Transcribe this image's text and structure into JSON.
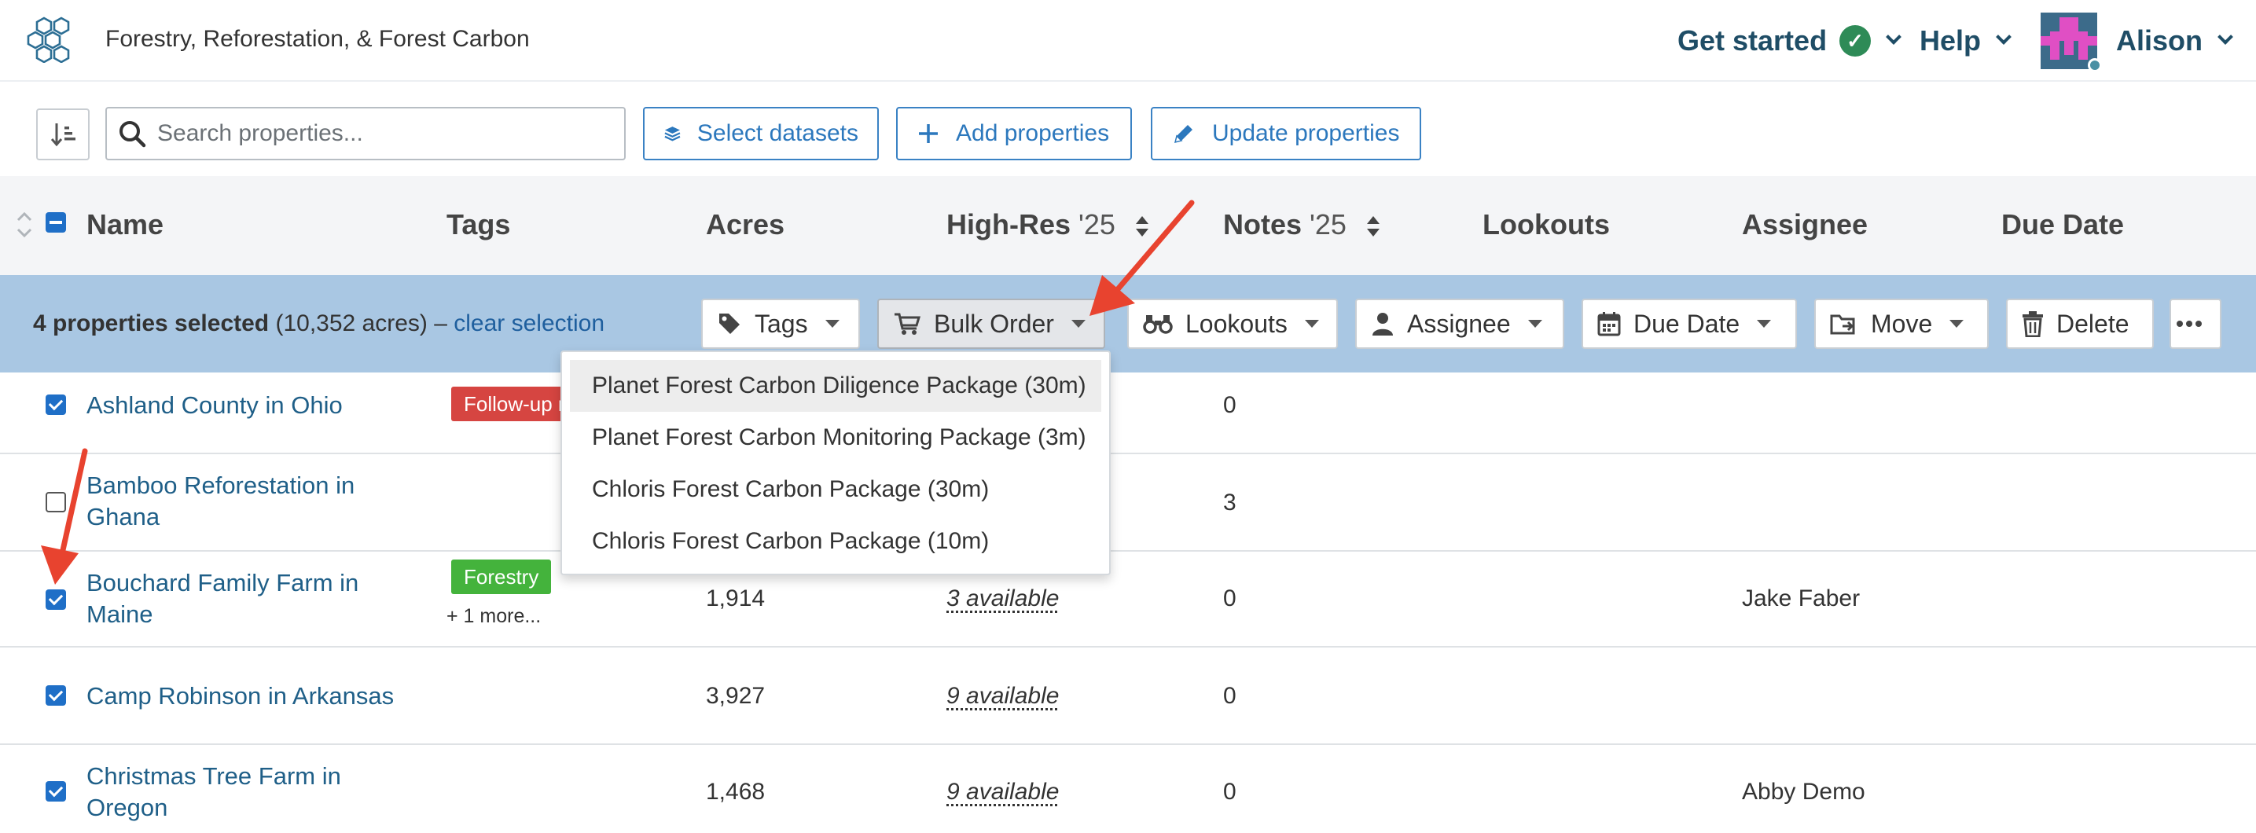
{
  "header": {
    "app_title": "Forestry, Reforestation, & Forest Carbon",
    "get_started_label": "Get started",
    "help_label": "Help",
    "user_name": "Alison"
  },
  "toolbar": {
    "search_placeholder": "Search properties...",
    "select_datasets_label": "Select datasets",
    "add_properties_label": "Add properties",
    "update_properties_label": "Update properties"
  },
  "table": {
    "columns": {
      "name": "Name",
      "tags": "Tags",
      "acres": "Acres",
      "highres": "High-Res",
      "highres_year": "'25",
      "notes": "Notes",
      "notes_year": "'25",
      "lookouts": "Lookouts",
      "assignee": "Assignee",
      "due_date": "Due Date"
    },
    "rows": [
      {
        "checked": true,
        "name": "Ashland County in Ohio",
        "tag": "Follow-up r",
        "acres": "",
        "highres": "",
        "notes": "0",
        "assignee": ""
      },
      {
        "checked": false,
        "name": "Bamboo Reforestation in Ghana",
        "tag": "",
        "acres": "",
        "highres": "",
        "notes": "3",
        "assignee": ""
      },
      {
        "checked": true,
        "name": "Bouchard Family Farm in Maine",
        "tag": "Forestry",
        "more": "+ 1 more...",
        "acres": "1,914",
        "highres": "3 available",
        "notes": "0",
        "assignee": "Jake Faber"
      },
      {
        "checked": true,
        "name": "Camp Robinson in Arkansas",
        "tag": "",
        "acres": "3,927",
        "highres": "9 available",
        "notes": "0",
        "assignee": ""
      },
      {
        "checked": true,
        "name": "Christmas Tree Farm in Oregon",
        "tag": "",
        "acres": "1,468",
        "highres": "9 available",
        "notes": "0",
        "assignee": "Abby Demo"
      }
    ]
  },
  "selection_bar": {
    "count_text": "4 properties selected",
    "acres_text": " (10,352 acres) – ",
    "clear_label": "clear selection",
    "tags_label": "Tags",
    "bulk_order_label": "Bulk Order",
    "lookouts_label": "Lookouts",
    "assignee_label": "Assignee",
    "due_date_label": "Due Date",
    "move_label": "Move",
    "delete_label": "Delete"
  },
  "bulk_order_menu": {
    "items": [
      "Planet Forest Carbon Diligence Package (30m)",
      "Planet Forest Carbon Monitoring Package (3m)",
      "Chloris Forest Carbon Package (30m)",
      "Chloris Forest Carbon Package (10m)"
    ]
  },
  "colors": {
    "brand_navy": "#1f4d66",
    "link_blue": "#2c78bd",
    "selection_bar": "#a9c7e3",
    "tag_red": "#d64541",
    "tag_green": "#44b33c",
    "annotation_red": "#e8432f",
    "success_green": "#2e8b57"
  }
}
